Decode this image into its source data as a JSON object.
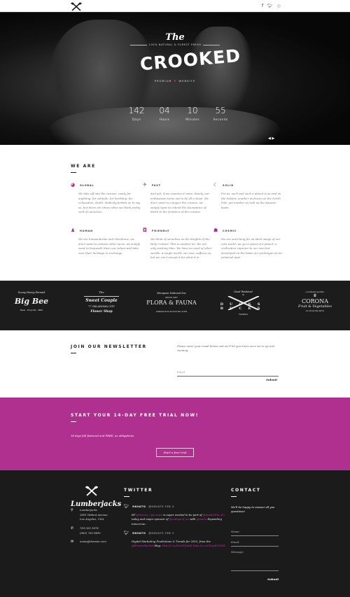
{
  "topbar": {
    "logo": "crossed-axes-logo",
    "social": [
      "facebook",
      "twitter",
      "dribbble"
    ]
  },
  "hero": {
    "brand_the": "The",
    "brand_tagline": "100% NATURAL & FOREST FRESH",
    "brand_name": "CROOKED",
    "brand_sub_left": "PREMIUM",
    "brand_sub_star": "★",
    "brand_sub_right": "WEBSITE",
    "countdown": [
      {
        "value": "142",
        "label": "Days"
      },
      {
        "value": "04",
        "label": "Hours"
      },
      {
        "value": "10",
        "label": "Minutes"
      },
      {
        "value": "55",
        "label": "Seconds"
      }
    ],
    "audio_icon": "◀ ▶"
  },
  "we_are": {
    "title": "WE ARE",
    "features": [
      {
        "title": "GLOBAL",
        "icon": "globe-icon",
        "glyph": "◕",
        "text": "We take off into the cosmos, ready for anything: for solitude, for hardship, for exhaustion, death. Modesty forbids us to say so, but there are times when we think pretty well of ourselves."
      },
      {
        "title": "FAST",
        "icon": "rocket-icon",
        "glyph": "✈",
        "text": "And yet, if we examine it more closely, our enthusiasm turns out to be all a sham. We don't want to conquer the cosmos, we simply want to extend the boundaries of Earth to the frontiers of the cosmos."
      },
      {
        "title": "SOLID",
        "icon": "moon-icon",
        "glyph": "☾",
        "text": "For us, such and such a planet is as arid as the Sahara, another as frozen as the North Pole, yet another as lush as the Amazon basin."
      },
      {
        "title": "HUMAN",
        "icon": "person-icon",
        "glyph": "♟",
        "text": "We are humanitarian and chivalrous; we don't want to enslave other races, we simply want to bequeath them our values and take over their heritage in exchange."
      },
      {
        "title": "FRIENDLY",
        "icon": "github-icon",
        "glyph": "◘",
        "text": "We think of ourselves as the Knights of the Holy Contact. This is another lie. We are only seeking Man. We have no need of other worlds. A single world, our own, suffices us; but we can't accept it for what it is."
      },
      {
        "title": "COSMIC",
        "icon": "alien-icon",
        "glyph": "☗",
        "text": "We are searching for an ideal image of our own world: we go in quest of a planet, a civilization superior to our own but developed on the basis of a prototype of our primeval past."
      }
    ]
  },
  "logos": [
    {
      "name": "Big Bee",
      "top": "Sunny Honey Farmed",
      "bottom": "Bees · Propolis · Milk"
    },
    {
      "name": "Sweet Couple",
      "top": "The",
      "mid": "77 OKLAHOMA CITY",
      "bottom": "Flower Shop"
    },
    {
      "name": "FLORA & FAUNA",
      "top": "European National Zoo",
      "mid": "SINCE 1987",
      "bottom": "Animals from around the world"
    },
    {
      "name": "DUCKS  BUCKS",
      "top": "Good Weekend",
      "mid": "&",
      "bottom": "Tradition"
    },
    {
      "name": "CORONA",
      "top": "- excellent quality -",
      "mid": "Fruit & Vegetables",
      "bottom": "our street fine Africa"
    }
  ],
  "newsletter": {
    "title": "JOIN OUR NEWSLETTER",
    "description": "Please enter your email below and we'll let you know once we're up and running.",
    "email_placeholder": "Email",
    "submit_label": "Submit"
  },
  "trial": {
    "title": "START YOUR 14-DAY FREE TRIAL NOW!",
    "description": "14 days full featured and FREE, no obligations.",
    "button_label": "Start a free trial"
  },
  "footer": {
    "logo_name": "Lumberjacks",
    "address": [
      "Lumberjacks",
      "2801 Walnut Avenue",
      "Los Angeles, USA"
    ],
    "phones": [
      "763-302-1878",
      "(963) 763-9490"
    ],
    "email": "name@domain.com",
    "twitter_title": "TWITTER",
    "tweets": [
      {
        "author": "ENVATO",
        "handle": "@ENVATO FEB 4",
        "text_1": "RT ",
        "link_1": "@Sm2ne / @envato",
        "text_2": " is super excited to be part of ",
        "link_2": "@AwdsGirls_AU",
        "text_3": " today and major sponsor of ",
        "link_3": "@codepenf_au",
        "text_4": " with ",
        "link_4": "@mailo",
        "text_5": " Expanding tomorrow..."
      },
      {
        "author": "ENVATO",
        "handle": "@ENVATO FEB 3",
        "text_1": "Digital Marketing Predictions & Trends for 2015, from the ",
        "link_1": "@EnvatoMarket",
        "text_2": " blog: ",
        "link_2": "http://t.co/Dss3PJcbAb",
        "text_3": " ",
        "link_3": "http://t.co/CEvpWV3XIL",
        "text_4": "",
        "link_4": "",
        "text_5": ""
      }
    ],
    "contact_title": "CONTACT",
    "contact_desc": "We'll be happy to answer all you questions!",
    "name_placeholder": "Name:",
    "email_placeholder": "Email:",
    "message_placeholder": "Message:",
    "submit_label": "Submit"
  },
  "colors": {
    "accent": "#b0308f",
    "dark": "#1b1b1b",
    "logos_bg": "#1c1c1c"
  }
}
